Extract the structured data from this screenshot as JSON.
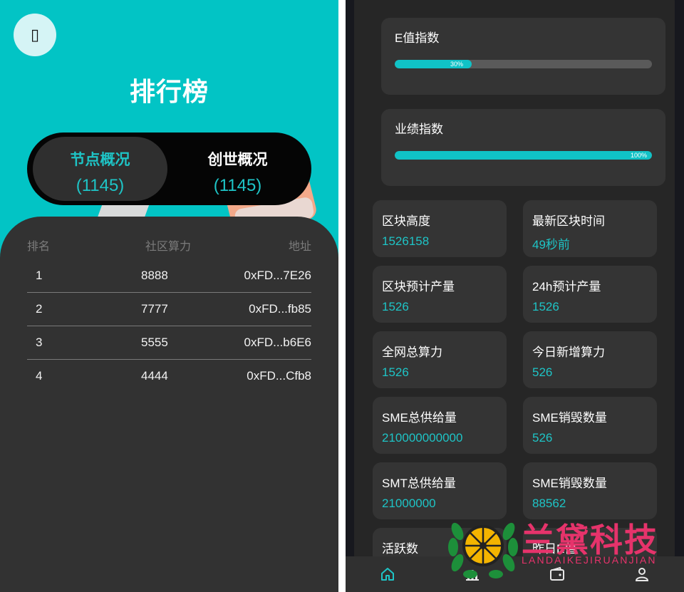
{
  "left": {
    "back_icon": "ellipsis-box-icon",
    "back_glyph": "▯",
    "title": "排行榜",
    "tabs": [
      {
        "label": "节点概况",
        "count": "(1145)",
        "active": true
      },
      {
        "label": "创世概况",
        "count": "(1145)",
        "active": false
      }
    ],
    "table": {
      "headers": [
        "排名",
        "社区算力",
        "地址"
      ],
      "rows": [
        {
          "rank": "1",
          "power": "8888",
          "address": "0xFD...7E26"
        },
        {
          "rank": "2",
          "power": "7777",
          "address": "0xFD...fb85"
        },
        {
          "rank": "3",
          "power": "5555",
          "address": "0xFD...b6E6"
        },
        {
          "rank": "4",
          "power": "4444",
          "address": "0xFD...Cfb8"
        }
      ]
    }
  },
  "right": {
    "progress": [
      {
        "label": "E值指数",
        "percent": 30,
        "percent_label": "30%"
      },
      {
        "label": "业绩指数",
        "percent": 100,
        "percent_label": "100%"
      }
    ],
    "stats": [
      {
        "label": "区块高度",
        "value": "1526158"
      },
      {
        "label": "最新区块时间",
        "value": "49秒前"
      },
      {
        "label": "区块预计产量",
        "value": "1526"
      },
      {
        "label": "24h预计产量",
        "value": "1526"
      },
      {
        "label": "全网总算力",
        "value": "1526"
      },
      {
        "label": "今日新增算力",
        "value": "526"
      },
      {
        "label": "SME总供给量",
        "value": "210000000000"
      },
      {
        "label": "SME销毁数量",
        "value": "526"
      },
      {
        "label": "SMT总供给量",
        "value": "21000000"
      },
      {
        "label": "SME销毁数量",
        "value": "88562"
      },
      {
        "label": "活跃数",
        "value": ""
      },
      {
        "label": "昨日E值",
        "value": ""
      }
    ],
    "nav": [
      {
        "icon": "home-icon",
        "active": true
      },
      {
        "icon": "chart-icon",
        "active": false
      },
      {
        "icon": "wallet-icon",
        "active": false
      },
      {
        "icon": "user-icon",
        "active": false
      }
    ]
  },
  "watermark": {
    "text_zh": "兰黛科技",
    "text_en": "LANDAIKEJIRUANJIAN"
  },
  "colors": {
    "accent": "#1ec4c6",
    "left_bg": "#02c4c5",
    "card_bg": "#323232",
    "watermark": "#e6336b"
  }
}
